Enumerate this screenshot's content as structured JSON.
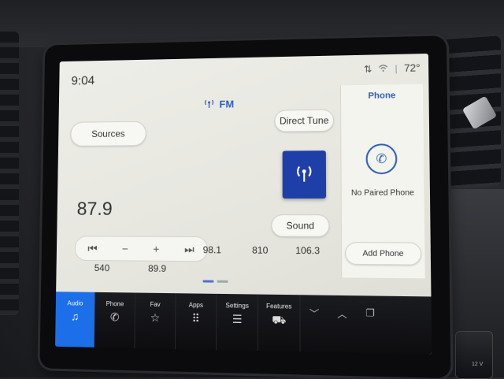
{
  "status": {
    "time": "9:04",
    "temperature": "72°"
  },
  "audio": {
    "source_band": "FM",
    "sources_label": "Sources",
    "direct_tune_label": "Direct Tune",
    "sound_label": "Sound",
    "frequency": "87.9",
    "controls": {
      "prev": "⏮",
      "minus": "−",
      "plus": "+",
      "next": "⏭"
    },
    "presets_row1": [
      "98.1",
      "810",
      "106.3"
    ],
    "presets_row2": [
      "540",
      "89.9"
    ]
  },
  "phone": {
    "title": "Phone",
    "status": "No Paired Phone",
    "add_label": "Add Phone"
  },
  "nav": {
    "audio": "Audio",
    "phone": "Phone",
    "fav": "Fav",
    "apps": "Apps",
    "settings": "Settings",
    "features": "Features"
  },
  "hardware": {
    "knob_label": "12 V"
  },
  "colors": {
    "accent": "#2f5fb8",
    "tile": "#1f3fa8",
    "nav_active": "#1c6fe8"
  }
}
